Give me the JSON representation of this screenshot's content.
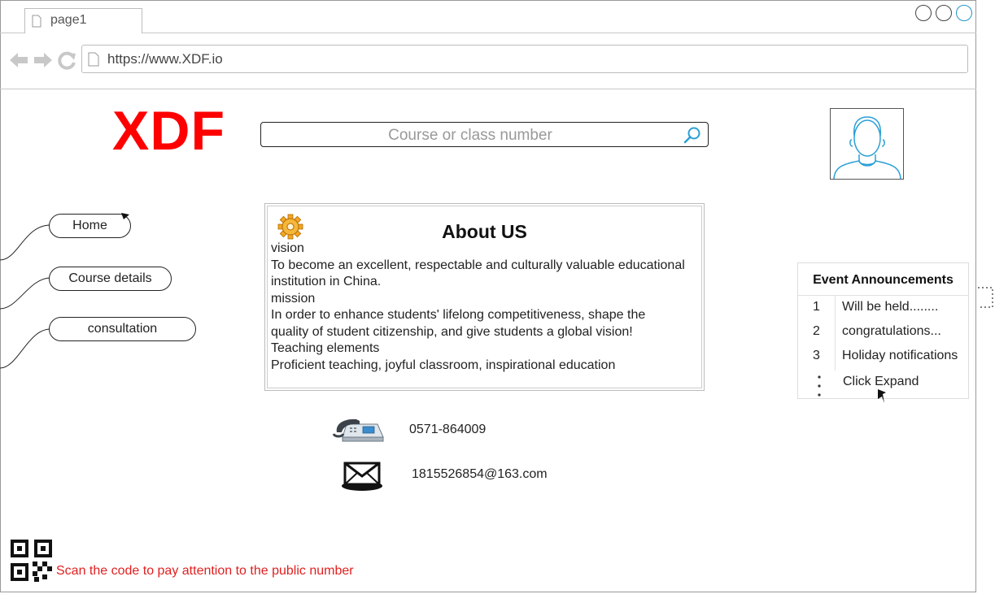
{
  "browser": {
    "tab_label": "page1",
    "url": "https://www.XDF.io"
  },
  "header": {
    "logo": "XDF",
    "search_placeholder": "Course or class number"
  },
  "nav": {
    "items": [
      {
        "label": "Home"
      },
      {
        "label": "Course details"
      },
      {
        "label": "consultation"
      }
    ]
  },
  "about": {
    "title": "About US",
    "lines": [
      "vision",
      "To become an excellent, respectable and culturally valuable educational institution in China.",
      "mission",
      "In order to enhance students' lifelong competitiveness, shape the quality of student citizenship, and give students a global vision!",
      "Teaching elements",
      "Proficient teaching, joyful classroom, inspirational education"
    ]
  },
  "contact": {
    "phone": "0571-864009",
    "email": "1815526854@163.com"
  },
  "announcements": {
    "title": "Event Announcements",
    "items": [
      {
        "num": "1",
        "text": "Will be held........"
      },
      {
        "num": "2",
        "text": "congratulations..."
      },
      {
        "num": "3",
        "text": "Holiday notifications"
      }
    ],
    "expand_label": "Click Expand"
  },
  "footer": {
    "qr_caption": "Scan the code to pay attention to the public number"
  },
  "colors": {
    "logo": "#ff0000",
    "qr_caption": "#e02020",
    "search_icon": "#2a9fd6",
    "avatar_line": "#2a9fd6"
  }
}
